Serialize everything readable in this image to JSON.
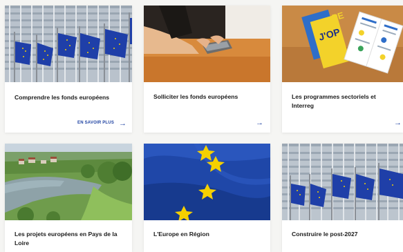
{
  "cards": [
    {
      "title": "Comprendre les fonds européens",
      "link_label": "EN SAVOIR PLUS",
      "arrow": "→"
    },
    {
      "title": "Solliciter les fonds européens",
      "arrow": "→"
    },
    {
      "title": "Les programmes sectoriels et Interreg",
      "arrow": "→"
    },
    {
      "title": "Les projets européens en Pays de la Loire"
    },
    {
      "title": "L'Europe en Région"
    },
    {
      "title": "Construire le post-2027"
    }
  ],
  "booklet": {
    "cover_text": "J'OP",
    "cover_text_back": "PE"
  },
  "colors": {
    "accent": "#1b3fa0",
    "eu_blue": "#1f3fa8",
    "eu_star": "#f5d000"
  }
}
